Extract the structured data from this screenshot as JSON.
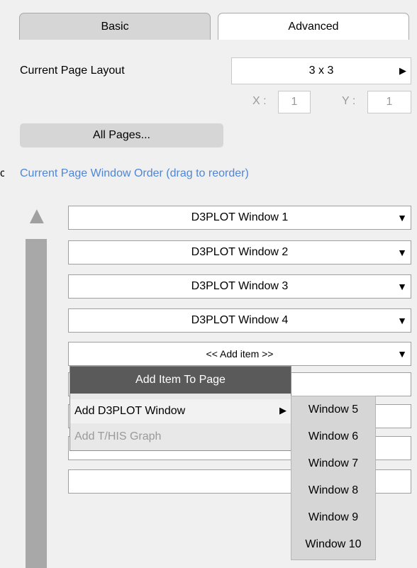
{
  "tabs": {
    "basic": "Basic",
    "advanced": "Advanced"
  },
  "layout": {
    "label": "Current Page Layout",
    "value": "3 x 3",
    "x_label": "X :",
    "x_value": "1",
    "y_label": "Y :",
    "y_value": "1"
  },
  "all_pages_label": "All Pages...",
  "order_heading": "Current Page Window Order (drag to reorder)",
  "cut_text": "c",
  "windows": [
    "D3PLOT Window 1",
    "D3PLOT Window 2",
    "D3PLOT Window 3",
    "D3PLOT Window 4"
  ],
  "add_item": "<< Add item >>",
  "menu": {
    "title": "Add Item To Page",
    "items": [
      "Add D3PLOT Window",
      "Add T/HIS Graph"
    ]
  },
  "submenu": [
    "Window 5",
    "Window 6",
    "Window 7",
    "Window 8",
    "Window 9",
    "Window 10"
  ],
  "colors": {
    "accent_text": "#4f86d6",
    "menu_header": "#5a5a5a"
  },
  "icons": {
    "dropdown": "▼",
    "submenu_arrow": "▶",
    "scroll_up": "▲"
  }
}
